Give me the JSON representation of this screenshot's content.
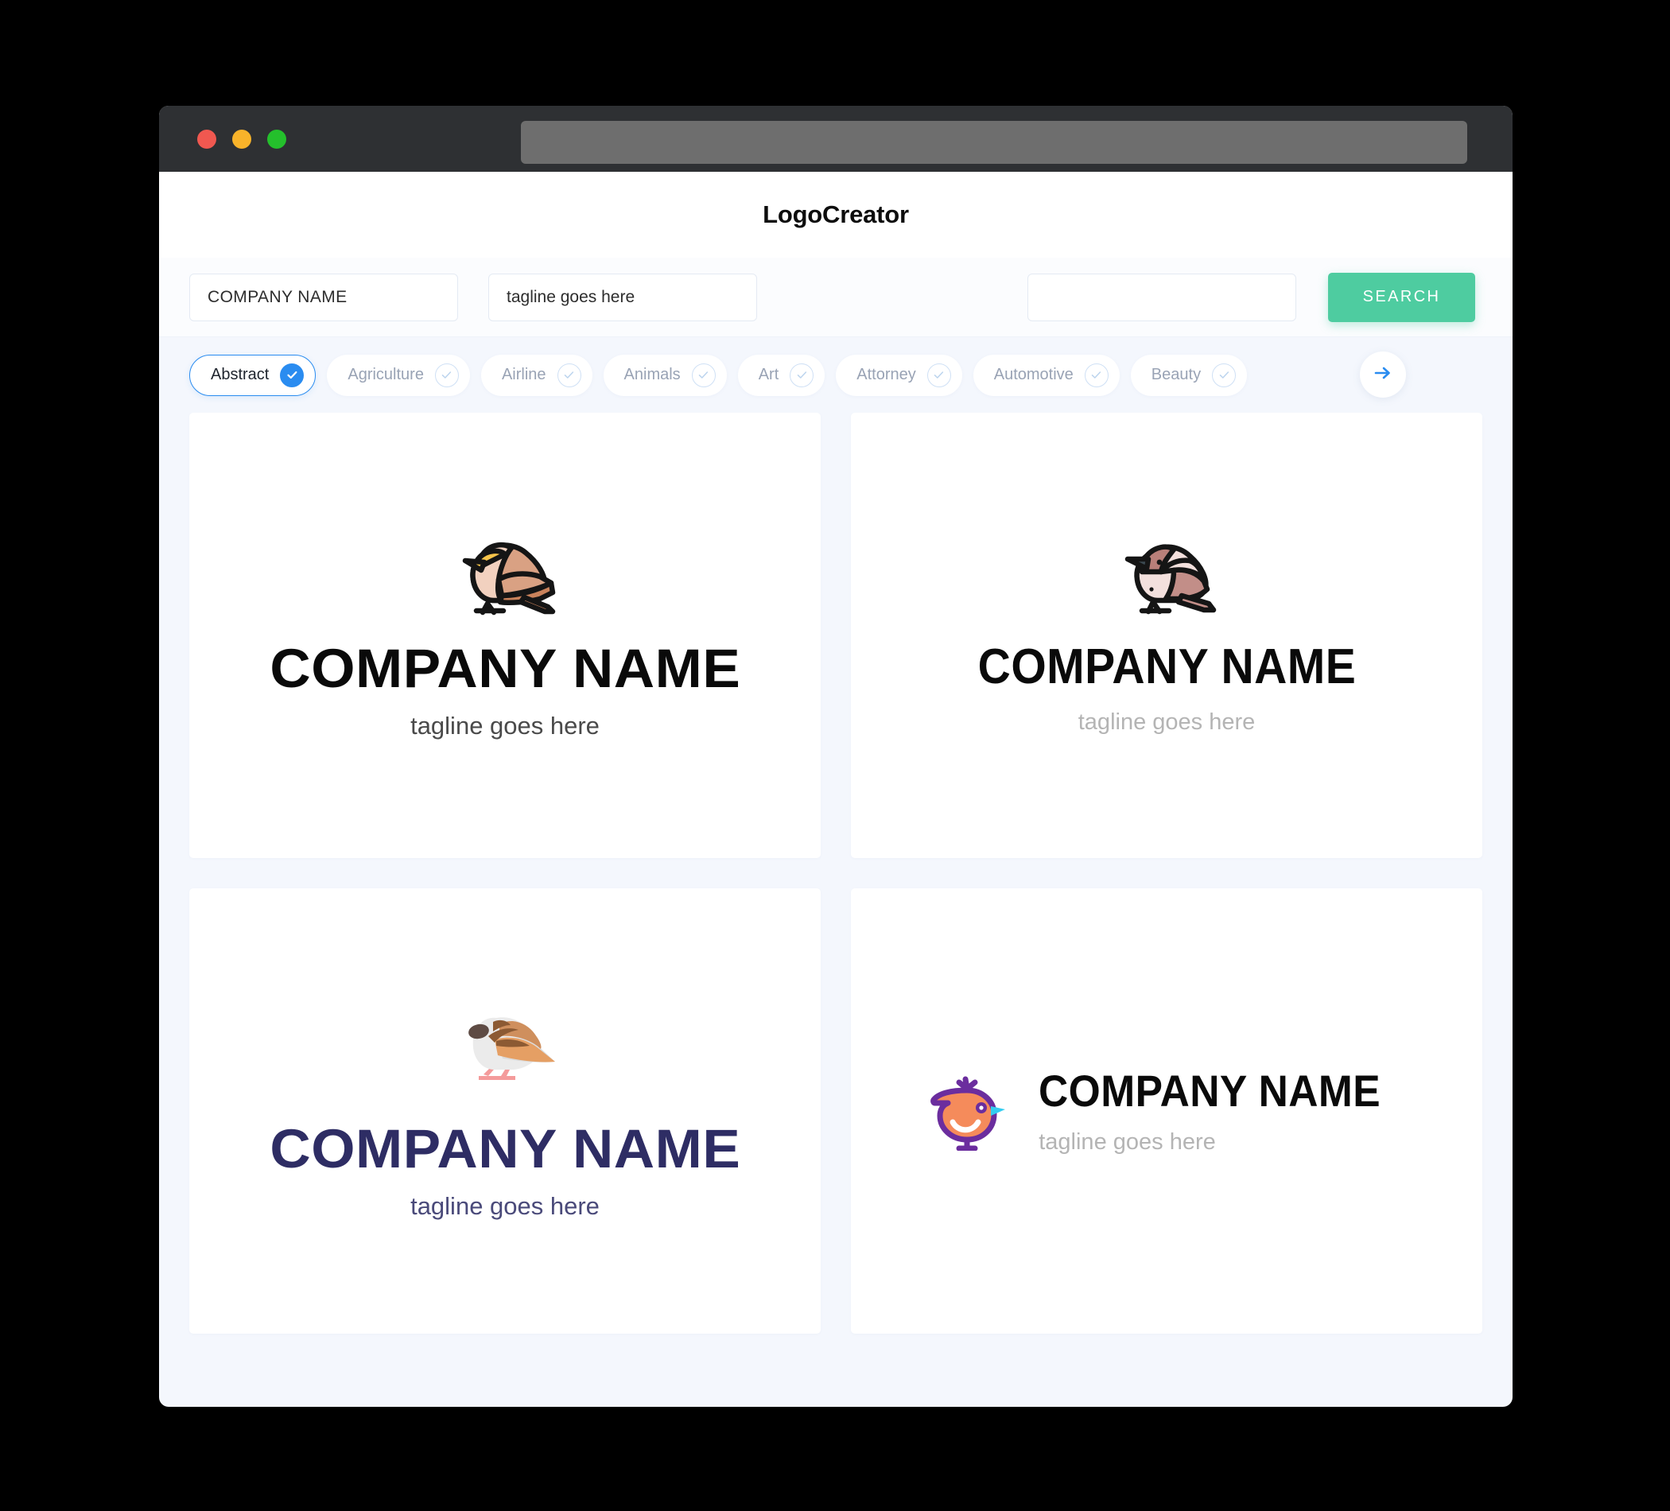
{
  "window": {
    "traffic_lights": [
      {
        "name": "close",
        "color": "#f05850"
      },
      {
        "name": "minimize",
        "color": "#f8b32a"
      },
      {
        "name": "maximize",
        "color": "#24c02c"
      }
    ],
    "url_bar_value": ""
  },
  "header": {
    "title": "LogoCreator"
  },
  "search": {
    "company_name_value": "COMPANY NAME",
    "company_name_placeholder": "COMPANY NAME",
    "tagline_value": "tagline goes here",
    "tagline_placeholder": "tagline goes here",
    "extra_value": "",
    "extra_placeholder": "",
    "search_label": "SEARCH",
    "search_button_color": "#4ecca0"
  },
  "categories": {
    "accent_color": "#2a8cf0",
    "next_icon": "arrow-right-icon",
    "items": [
      {
        "label": "Abstract",
        "selected": true
      },
      {
        "label": "Agriculture",
        "selected": false
      },
      {
        "label": "Airline",
        "selected": false
      },
      {
        "label": "Animals",
        "selected": false
      },
      {
        "label": "Art",
        "selected": false
      },
      {
        "label": "Attorney",
        "selected": false
      },
      {
        "label": "Automotive",
        "selected": false
      },
      {
        "label": "Beauty",
        "selected": false
      }
    ]
  },
  "logos": [
    {
      "icon": "sparrow-bird-icon",
      "name": "COMPANY NAME",
      "tagline": "tagline goes here",
      "name_color": "#0a0a0a",
      "tagline_color": "#4a4a4a",
      "layout": "stacked"
    },
    {
      "icon": "sparrow-outline-bird-icon",
      "name": "COMPANY NAME",
      "tagline": "tagline goes here",
      "name_color": "#0a0a0a",
      "tagline_color": "#b4b4b4",
      "layout": "stacked"
    },
    {
      "icon": "flat-sparrow-bird-icon",
      "name": "COMPANY NAME",
      "tagline": "tagline goes here",
      "name_color": "#2e2d64",
      "tagline_color": "#4a4a7a",
      "layout": "stacked"
    },
    {
      "icon": "orange-chick-bird-icon",
      "name": "COMPANY NAME",
      "tagline": "tagline goes here",
      "name_color": "#0a0a0a",
      "tagline_color": "#b4b4b4",
      "layout": "horizontal"
    }
  ]
}
